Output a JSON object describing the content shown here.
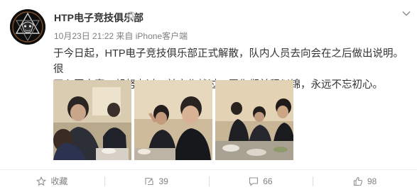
{
  "post": {
    "author": "HTP电子竞技俱乐部",
    "timestamp": "10月23日 21:22",
    "source_prefix": "来自",
    "source": "iPhone客户端",
    "text_line1": "于今日起，HTP电子竞技俱乐部正式解散，队内人员去向会在之后做出说明。很",
    "text_line2": "开心同大家一起努力过，并肩作战过，愿你们前程似锦，永远不忘初心。",
    "photos_count": 3
  },
  "actions": {
    "favorite_label": "收藏",
    "repost_count": "39",
    "comment_count": "66",
    "like_count": "98"
  },
  "icons": {
    "verify": "verified-badge-icon",
    "menu": "chevron-down-icon",
    "favorite": "star-icon",
    "repost": "repost-icon",
    "comment": "comment-icon",
    "like": "thumbs-up-icon"
  },
  "colors": {
    "text": "#333333",
    "meta": "#808080",
    "divider": "#ececec"
  }
}
